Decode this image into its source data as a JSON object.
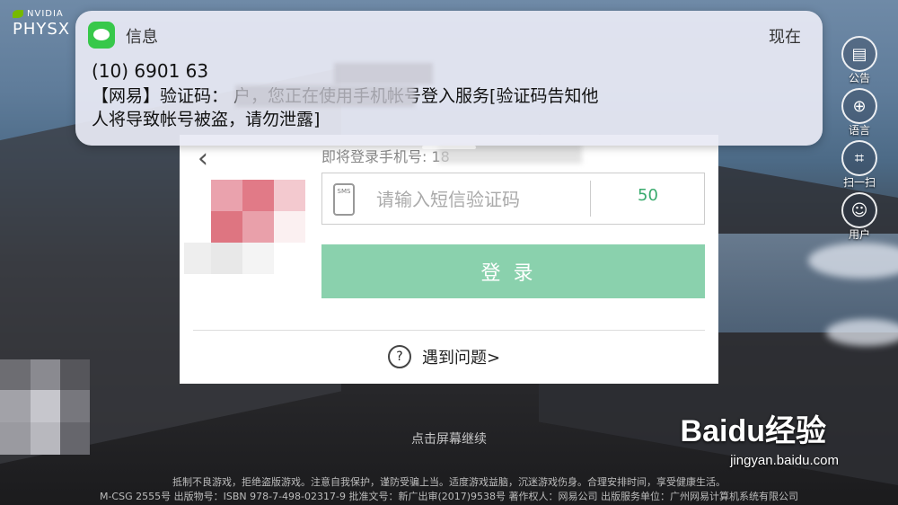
{
  "logo": {
    "brand": "NVIDIA",
    "product": "PHYSX"
  },
  "notification": {
    "app_name": "信息",
    "time": "现在",
    "sender": "(10) 6901 63",
    "body_line1": "【网易】验证码：                              户，您正在使用手机帐号登入服务[验证码告知他",
    "body_line2": "人将导致帐号被盗，请勿泄露]"
  },
  "side_buttons": [
    {
      "label": "公告",
      "icon": "notice-icon"
    },
    {
      "label": "语言",
      "icon": "globe-icon"
    },
    {
      "label": "扫一扫",
      "icon": "scan-icon"
    },
    {
      "label": "用户",
      "icon": "user-icon"
    }
  ],
  "login": {
    "phone_label": "即将登录手机号: 18",
    "code_placeholder": "请输入短信验证码",
    "sms_icon_text": "SMS",
    "countdown": "50",
    "login_label": "登录",
    "help_label": "遇到问题>"
  },
  "continue_text": "点击屏幕继续",
  "footer": {
    "line1": "抵制不良游戏，拒绝盗版游戏。注意自我保护，谨防受骗上当。适度游戏益脑，沉迷游戏伤身。合理安排时间，享受健康生活。",
    "line2": "M-CSG 2555号    出版物号：ISBN 978-7-498-02317-9    批准文号：新广出审(2017)9538号    著作权人：网易公司    出版服务单位：广州网易计算机系统有限公司"
  },
  "watermark": {
    "brand": "Baidu经验",
    "url": "jingyan.baidu.com"
  }
}
